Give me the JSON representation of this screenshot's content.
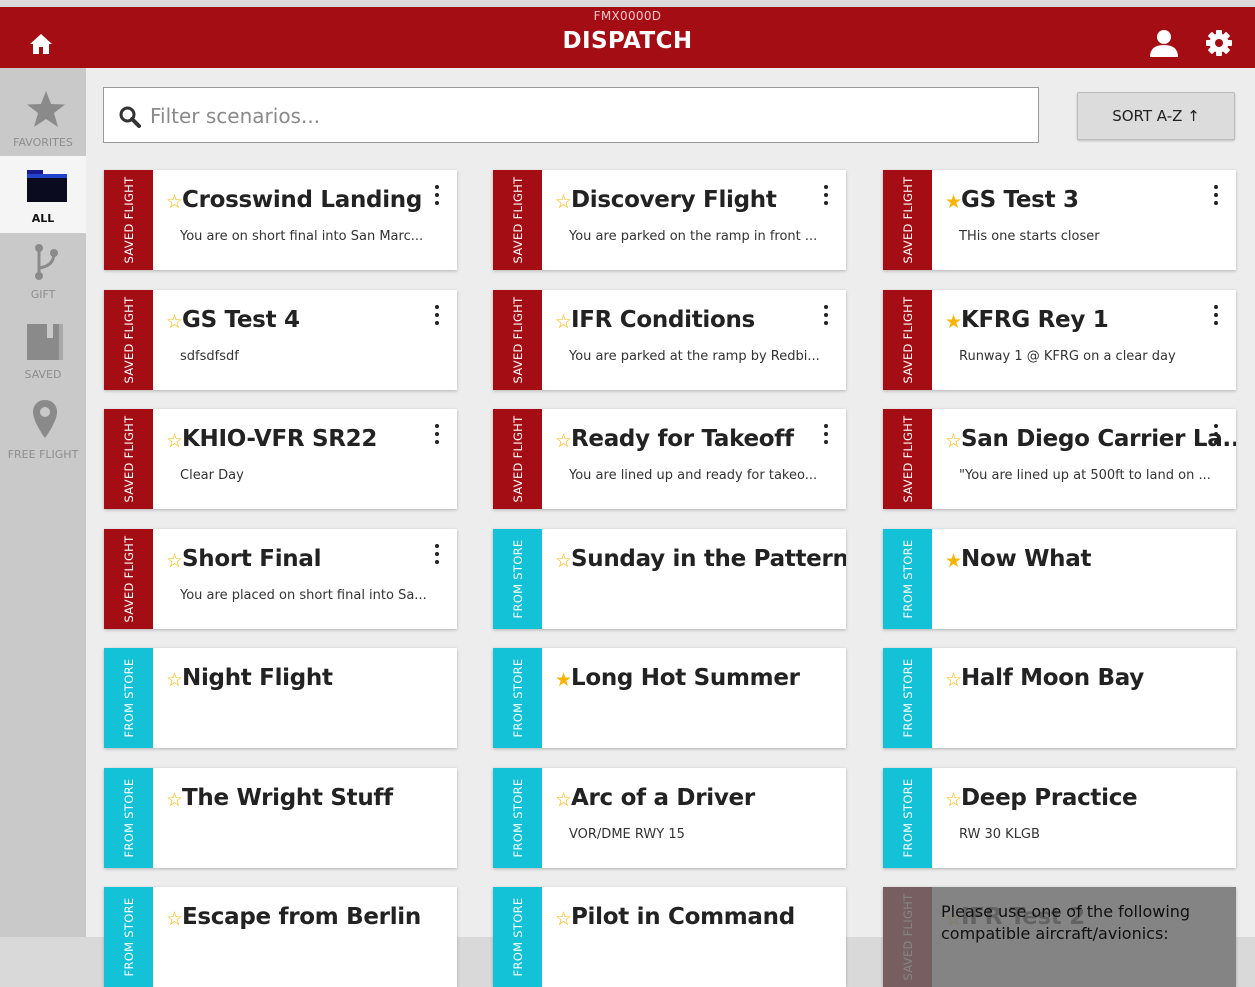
{
  "header": {
    "subtitle": "FMX0000D",
    "title": "DISPATCH"
  },
  "filter": {
    "placeholder": "Filter scenarios..."
  },
  "sort": {
    "label": "SORT A-Z ↑"
  },
  "sidebar": {
    "items": [
      {
        "label": "FAVORITES",
        "icon": "star-icon"
      },
      {
        "label": "ALL",
        "icon": "folder-icon",
        "active": true
      },
      {
        "label": "GIFT",
        "icon": "fork-icon"
      },
      {
        "label": "SAVED",
        "icon": "book-icon"
      },
      {
        "label": "FREE FLIGHT",
        "icon": "map-pin-icon"
      }
    ]
  },
  "colors": {
    "brand": "#a50d14",
    "store": "#13c2d6",
    "star": "#f7b500"
  },
  "cards": [
    {
      "tag": "SAVED FLIGHT",
      "title": "Crosswind Landing",
      "desc": "You are on short final into San Marc...",
      "fav": false,
      "menu": true
    },
    {
      "tag": "SAVED FLIGHT",
      "title": "Discovery Flight",
      "desc": "You are parked on the ramp in front ...",
      "fav": false,
      "menu": true
    },
    {
      "tag": "SAVED FLIGHT",
      "title": "GS Test 3",
      "desc": "THis one starts closer",
      "fav": true,
      "menu": true
    },
    {
      "tag": "SAVED FLIGHT",
      "title": "GS Test 4",
      "desc": "sdfsdfsdf",
      "fav": false,
      "menu": true
    },
    {
      "tag": "SAVED FLIGHT",
      "title": "IFR Conditions",
      "desc": "You are parked at the ramp by Redbi...",
      "fav": false,
      "menu": true
    },
    {
      "tag": "SAVED FLIGHT",
      "title": "KFRG Rey 1",
      "desc": "Runway 1 @ KFRG on a clear day",
      "fav": true,
      "menu": true
    },
    {
      "tag": "SAVED FLIGHT",
      "title": "KHIO-VFR SR22",
      "desc": "Clear Day",
      "fav": false,
      "menu": true
    },
    {
      "tag": "SAVED FLIGHT",
      "title": "Ready for Takeoff",
      "desc": "You are lined up and ready for takeo...",
      "fav": false,
      "menu": true
    },
    {
      "tag": "SAVED FLIGHT",
      "title": "San Diego Carrier La...",
      "desc": "\"You are lined up at 500ft to land on ...",
      "fav": false,
      "menu": true
    },
    {
      "tag": "SAVED FLIGHT",
      "title": "Short Final",
      "desc": "You are placed on short final into Sa...",
      "fav": false,
      "menu": true
    },
    {
      "tag": "FROM STORE",
      "title": "Sunday in the Pattern",
      "desc": "",
      "fav": false,
      "menu": false
    },
    {
      "tag": "FROM STORE",
      "title": "Now What",
      "desc": "",
      "fav": true,
      "menu": false
    },
    {
      "tag": "FROM STORE",
      "title": "Night Flight",
      "desc": "",
      "fav": false,
      "menu": false
    },
    {
      "tag": "FROM STORE",
      "title": "Long Hot Summer",
      "desc": "",
      "fav": true,
      "menu": false
    },
    {
      "tag": "FROM STORE",
      "title": "Half Moon Bay",
      "desc": "",
      "fav": false,
      "menu": false
    },
    {
      "tag": "FROM STORE",
      "title": "The Wright Stuff",
      "desc": "",
      "fav": false,
      "menu": false
    },
    {
      "tag": "FROM STORE",
      "title": "Arc of a Driver",
      "desc": "VOR/DME RWY 15",
      "fav": false,
      "menu": false
    },
    {
      "tag": "FROM STORE",
      "title": "Deep Practice",
      "desc": "RW 30 KLGB",
      "fav": false,
      "menu": false
    },
    {
      "tag": "FROM STORE",
      "title": "Escape from Berlin",
      "desc": "",
      "fav": false,
      "menu": false
    },
    {
      "tag": "FROM STORE",
      "title": "Pilot in Command",
      "desc": "",
      "fav": false,
      "menu": false
    },
    {
      "tag": "SAVED FLIGHT",
      "title": "IFR Test 2",
      "desc": "",
      "fav": false,
      "menu": false,
      "disabled": true,
      "overlay": "Please use one of the following compatible aircraft/avionics:"
    }
  ]
}
